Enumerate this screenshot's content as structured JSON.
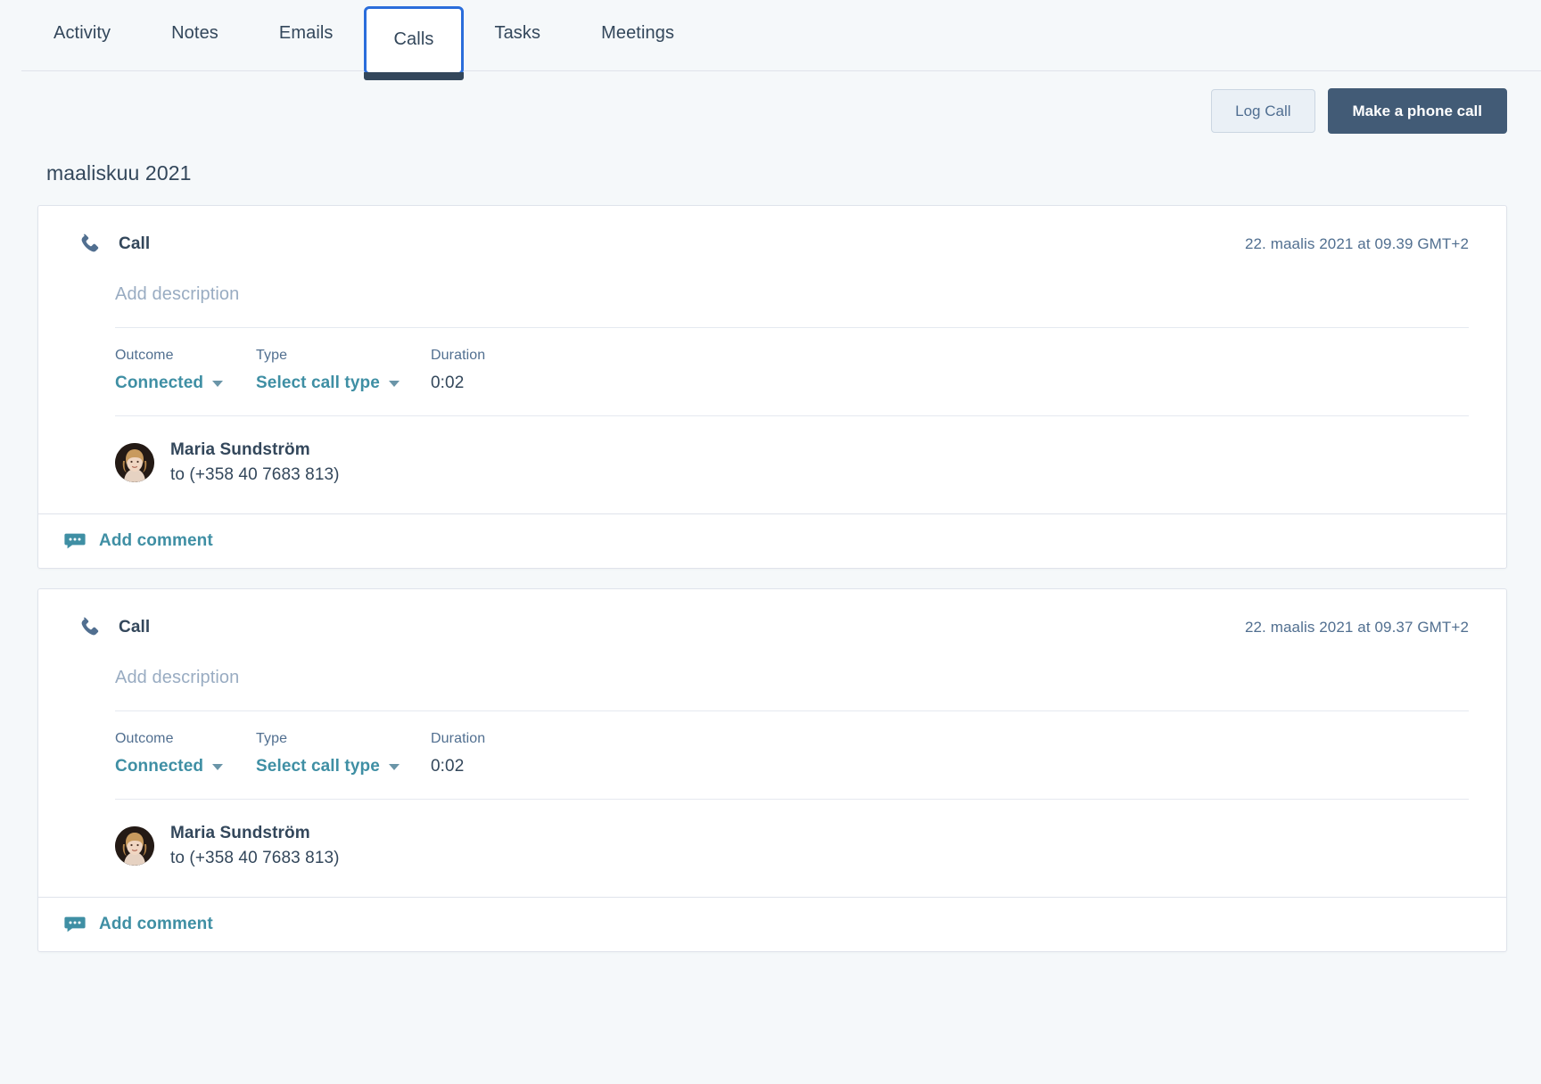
{
  "tabs": [
    {
      "label": "Activity",
      "active": false
    },
    {
      "label": "Notes",
      "active": false
    },
    {
      "label": "Emails",
      "active": false
    },
    {
      "label": "Calls",
      "active": true
    },
    {
      "label": "Tasks",
      "active": false
    },
    {
      "label": "Meetings",
      "active": false
    }
  ],
  "toolbar": {
    "log_call_label": "Log Call",
    "make_call_label": "Make a phone call"
  },
  "timeline": {
    "month_heading": "maaliskuu 2021"
  },
  "labels": {
    "outcome": "Outcome",
    "type": "Type",
    "duration": "Duration",
    "description_placeholder": "Add description",
    "add_comment": "Add comment",
    "to_prefix": "to"
  },
  "colors": {
    "page_bg": "#f5f8fa",
    "card_bg": "#ffffff",
    "border": "#dfe3eb",
    "text_primary": "#33475b",
    "text_secondary": "#516f90",
    "placeholder": "#99acc2",
    "link_teal": "#3f8fa4",
    "primary_button": "#425b76",
    "secondary_button": "#eaf0f6",
    "active_tab_ring": "#2a6ddb",
    "active_tab_underline": "#33475b"
  },
  "calls": [
    {
      "icon": "phone-icon",
      "title": "Call",
      "timestamp": "22. maalis 2021 at 09.39 GMT+2",
      "description": "Add description",
      "outcome": "Connected",
      "type": "Select call type",
      "duration": "0:02",
      "contact_name": "Maria Sundström",
      "contact_phone": "to (+358 40 7683 813)",
      "footer_action": "Add comment"
    },
    {
      "icon": "phone-icon",
      "title": "Call",
      "timestamp": "22. maalis 2021 at 09.37 GMT+2",
      "description": "Add description",
      "outcome": "Connected",
      "type": "Select call type",
      "duration": "0:02",
      "contact_name": "Maria Sundström",
      "contact_phone": "to (+358 40 7683 813)",
      "footer_action": "Add comment"
    }
  ]
}
